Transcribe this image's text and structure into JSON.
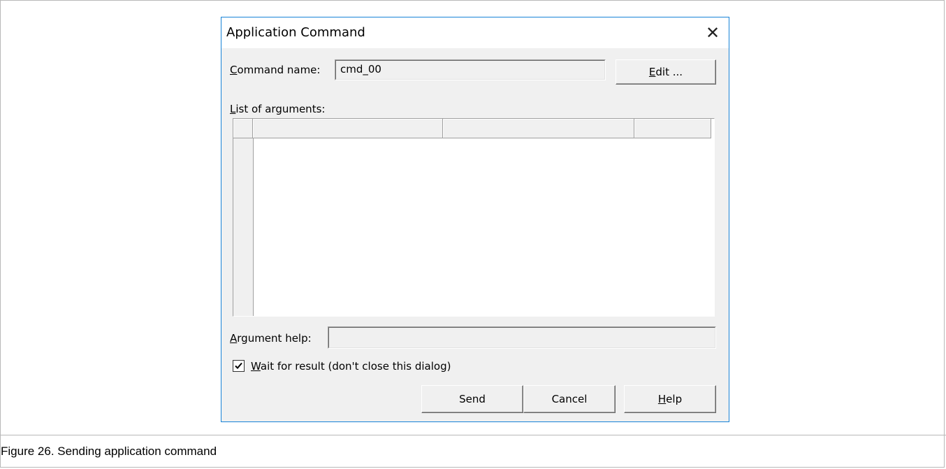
{
  "dialog": {
    "title": "Application Command",
    "close_glyph": "✕"
  },
  "command": {
    "label_accel": "C",
    "label_rest": "ommand name:",
    "value": "cmd_00",
    "edit_accel": "E",
    "edit_rest": "dit ..."
  },
  "arguments": {
    "label_accel": "L",
    "label_rest": "ist of arguments:",
    "columns": [
      "",
      "",
      ""
    ]
  },
  "help": {
    "label_accel": "A",
    "label_rest": "rgument help:",
    "value": ""
  },
  "wait": {
    "checked": true,
    "label_accel": "W",
    "label_rest": "ait for result (don't close this dialog)"
  },
  "buttons": {
    "send": "Send",
    "cancel": "Cancel",
    "help_accel": "H",
    "help_rest": "elp"
  },
  "caption": "Figure 26. Sending application command",
  "colors": {
    "dialog_border": "#1883d7",
    "dialog_bg": "#f0f0f0"
  }
}
